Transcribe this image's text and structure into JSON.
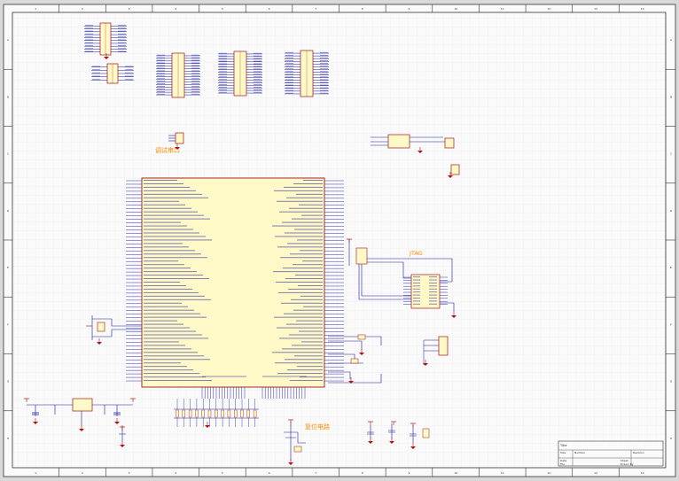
{
  "sheet": {
    "border_cols": [
      "1",
      "2",
      "3",
      "4",
      "5",
      "6",
      "7",
      "8",
      "9",
      "10",
      "11",
      "12",
      "13",
      "14",
      "15",
      "16"
    ],
    "border_rows": [
      "A",
      "B",
      "C",
      "D",
      "E",
      "F",
      "G",
      "H",
      "I",
      "J"
    ]
  },
  "annotations": {
    "debug_serial": "调试串口",
    "jtag": "JTAG",
    "reset_circuit": "复位电路"
  },
  "title_block": {
    "title_label": "Title",
    "size_label": "Size",
    "number_label": "Number",
    "revision_label": "Revision",
    "date_label": "Date",
    "file_label": "File",
    "sheet_label": "Sheet",
    "drawn_by_label": "Drawn By"
  },
  "colors": {
    "wire": "#1a1aa0",
    "chip_fill": "#fff9c8",
    "chip_stroke": "#a31515",
    "power": "#b01010",
    "label": "#1a1aa0",
    "note": "#ff8c00",
    "grid": "#e3e3e3",
    "paper": "#fafafa"
  }
}
